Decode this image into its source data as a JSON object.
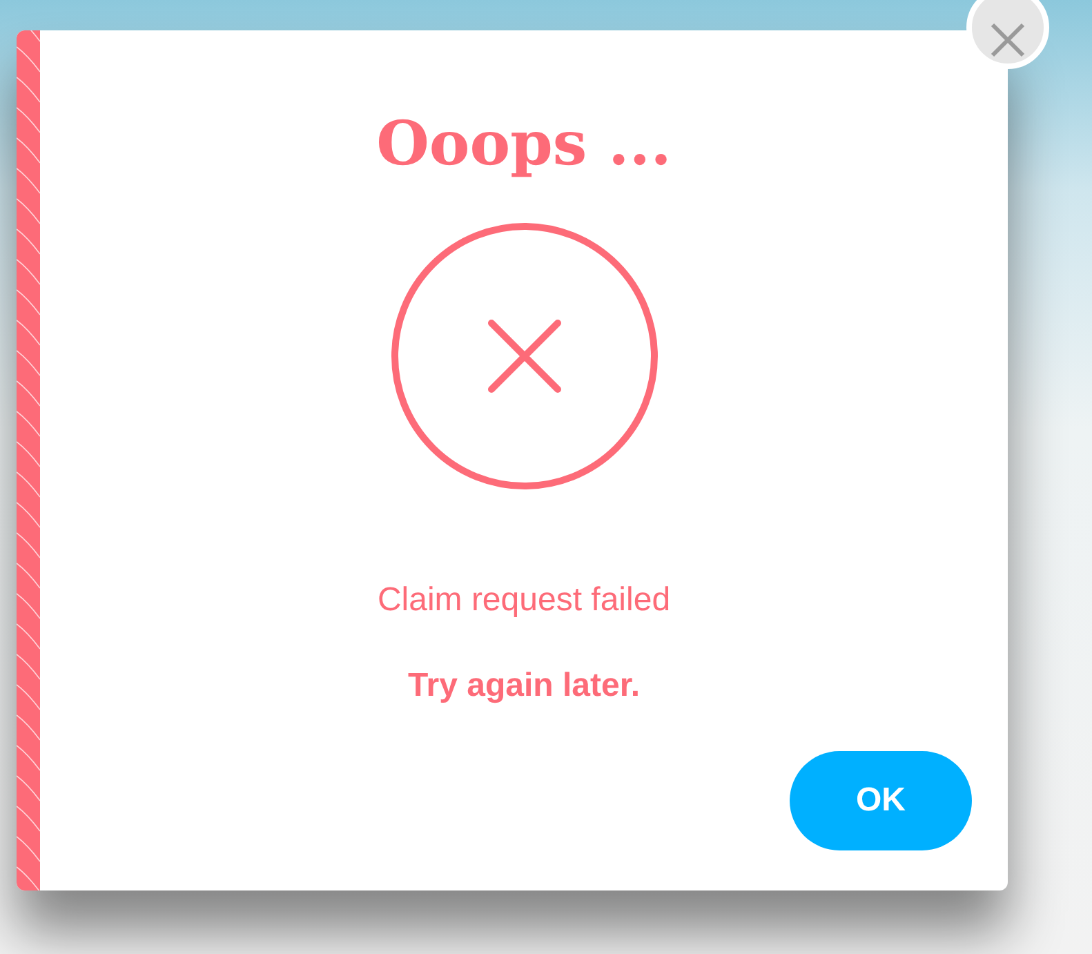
{
  "dialog": {
    "title": "Ooops ...",
    "message": "Claim request failed",
    "detail": "Try again later.",
    "button": "OK"
  }
}
